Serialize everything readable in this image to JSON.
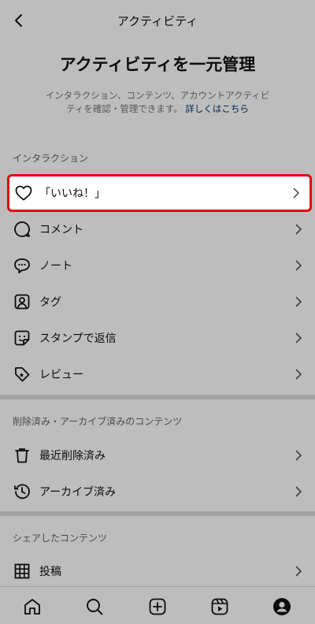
{
  "header": {
    "title": "アクティビティ"
  },
  "hero": {
    "title": "アクティビティを一元管理",
    "description": "インタラクション、コンテンツ、アカウントアクティビティを確認・管理できます。",
    "link": "詳しくはこちら"
  },
  "sections": {
    "interaction": {
      "header": "インタラクション",
      "items": [
        {
          "label": "「いいね！」",
          "icon": "heart-icon"
        },
        {
          "label": "コメント",
          "icon": "comment-icon"
        },
        {
          "label": "ノート",
          "icon": "note-icon"
        },
        {
          "label": "タグ",
          "icon": "tag-icon"
        },
        {
          "label": "スタンプで返信",
          "icon": "sticker-icon"
        },
        {
          "label": "レビュー",
          "icon": "review-icon"
        }
      ]
    },
    "removed": {
      "header": "削除済み・アーカイブ済みのコンテンツ",
      "items": [
        {
          "label": "最近削除済み",
          "icon": "trash-icon"
        },
        {
          "label": "アーカイブ済み",
          "icon": "archive-icon"
        }
      ]
    },
    "shared": {
      "header": "シェアしたコンテンツ",
      "items": [
        {
          "label": "投稿",
          "icon": "grid-icon"
        }
      ]
    }
  },
  "bottom_nav": [
    "home-icon",
    "search-icon",
    "create-icon",
    "reels-icon",
    "profile-icon"
  ],
  "colors": {
    "highlight_border": "#e8000e",
    "link": "#00376b",
    "overlay": "rgba(0,0,0,0.26)"
  }
}
